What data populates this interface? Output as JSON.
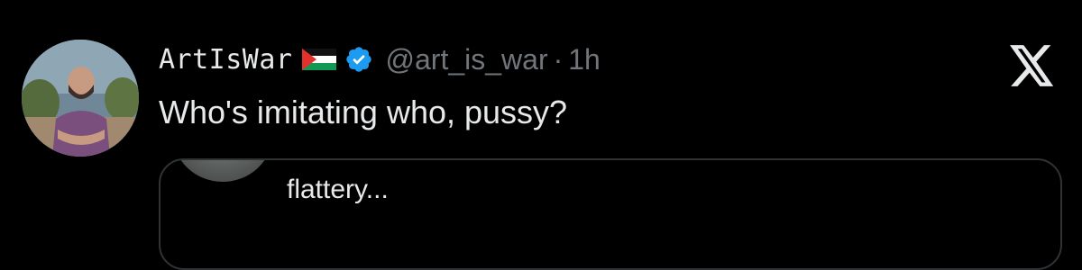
{
  "tweet": {
    "display_name": "ArtIsWar",
    "handle": "@art_is_war",
    "separator": "·",
    "timestamp": "1h",
    "text": "Who's imitating who, pussy?",
    "flag_icon": "palestine-flag-icon",
    "verified_icon": "verified-badge-icon",
    "verified_color": "#1d9bf0"
  },
  "quoted_tweet": {
    "text": "flattery..."
  },
  "brand": {
    "logo_icon": "x-logo-icon"
  },
  "colors": {
    "background": "#000000",
    "primary_text": "#e7e9ea",
    "secondary_text": "#71767b",
    "border": "#2f3336"
  }
}
